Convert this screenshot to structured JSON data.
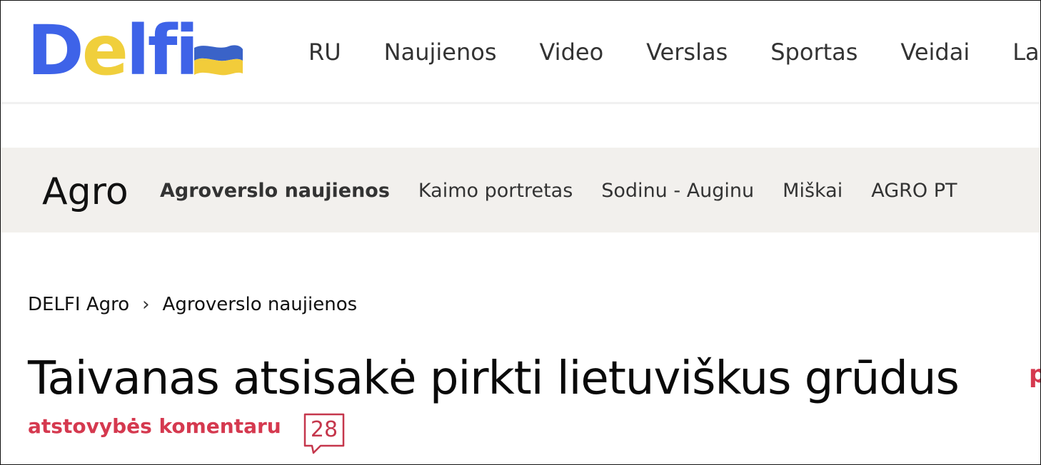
{
  "header": {
    "logo": {
      "letters": [
        "D",
        "e",
        "l",
        "f",
        "i"
      ],
      "colors": {
        "blue": "#3e63e8",
        "yellow": "#f0cf3c"
      },
      "flag_icon": "ukraine-flag-icon"
    },
    "nav": [
      "RU",
      "Naujienos",
      "Video",
      "Verslas",
      "Sportas",
      "Veidai",
      "Lai"
    ]
  },
  "section": {
    "title": "Agro",
    "nav": [
      {
        "label": "Agroverslo naujienos",
        "active": true
      },
      {
        "label": "Kaimo portretas",
        "active": false
      },
      {
        "label": "Sodinu - Auginu",
        "active": false
      },
      {
        "label": "Miškai",
        "active": false
      },
      {
        "label": "AGRO PT",
        "active": false
      }
    ]
  },
  "breadcrumb": {
    "items": [
      "DELFI Agro",
      "Agroverslo naujienos"
    ],
    "separator": "›"
  },
  "article": {
    "title_line1": "Taivanas atsisakė pirkti lietuviškus grūdus",
    "title_line1_overflow": "p",
    "title_line2": "atstovybės komentaru",
    "comments_count": "28",
    "accent_color": "#d5394f"
  }
}
